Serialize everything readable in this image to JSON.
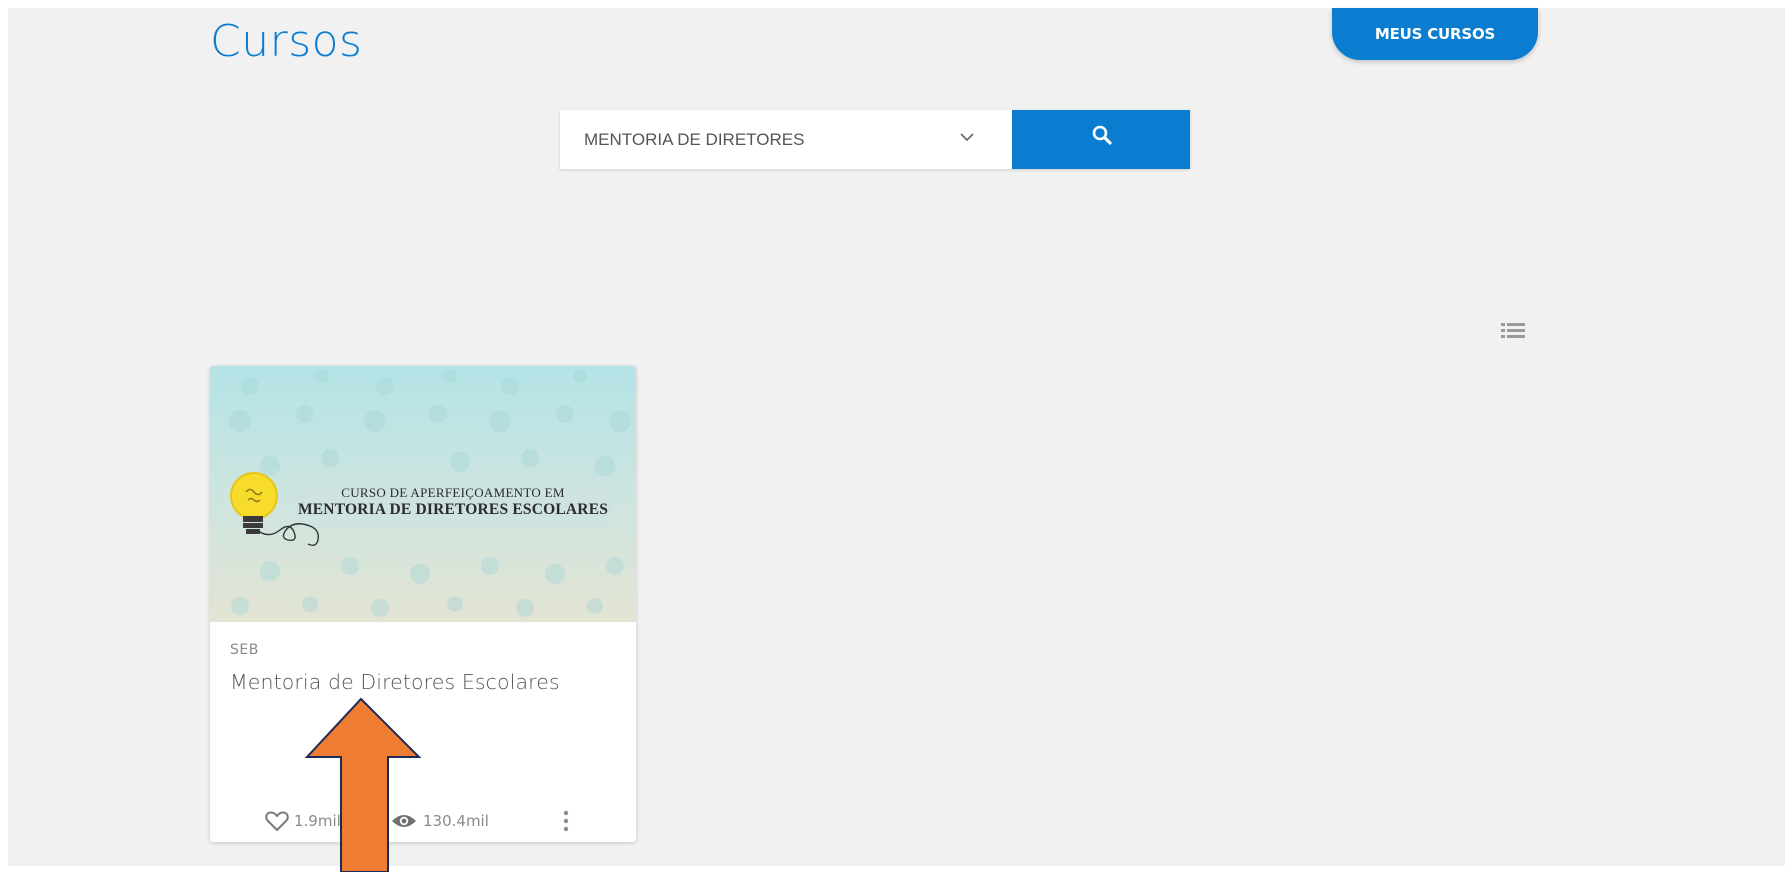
{
  "header": {
    "title": "Cursos",
    "my_courses_button": "MEUS CURSOS"
  },
  "search": {
    "selected_value": "MENTORIA DE DIRETORES",
    "search_icon": "search-icon",
    "dropdown_icon": "chevron-down-icon"
  },
  "view_toggle": {
    "icon": "list-view-icon"
  },
  "courses": [
    {
      "thumbnail": {
        "line1": "CURSO DE APERFEIÇOAMENTO EM",
        "line2": "MENTORIA DE DIRETORES ESCOLARES",
        "icon": "lightbulb-icon"
      },
      "category": "SEB",
      "title": "Mentoria de Diretores Escolares",
      "likes": "1.9mil",
      "views": "130.4mil",
      "menu_icon": "more-vertical-icon"
    }
  ],
  "colors": {
    "accent": "#0a7dd0",
    "background": "#f1f1f1",
    "annotation_arrow": "#ee7d33"
  }
}
